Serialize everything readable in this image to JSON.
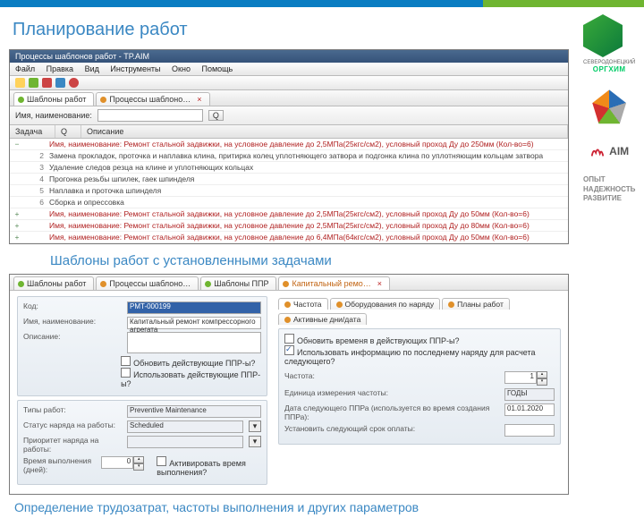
{
  "page_title": "Планирование работ",
  "caption_templates": "Шаблоны работ с установленными задачами",
  "caption_params": "Определение трудозатрат, частоты выполнения и других параметров",
  "win1": {
    "title": "Процессы шаблонов работ - TP.AIM",
    "menu": [
      "Файл",
      "Правка",
      "Вид",
      "Инструменты",
      "Окно",
      "Помощь"
    ],
    "tabs": [
      {
        "label": "Шаблоны работ"
      },
      {
        "label": "Процессы шаблоно…"
      }
    ],
    "search": {
      "name": "Имя, наименование:",
      "q": "Q"
    },
    "gridcols": [
      "Задача",
      "Q",
      "Описание"
    ],
    "rows": [
      {
        "red": true,
        "exp": "−",
        "n": "",
        "t": "Имя, наименование: Ремонт стальной задвижки, на условное давление до 2,5МПа(25кгс/см2), условный проход Ду до 250мм (Кол-во=6)"
      },
      {
        "n": "2",
        "t": "Замена прокладок, проточка и наплавка клина, притирка колец уплотняющего затвора и подгонка клина по уплотняющим кольцам затвора"
      },
      {
        "n": "3",
        "t": "Удаление следов резца на клине и уплотняющих кольцах"
      },
      {
        "n": "4",
        "t": "Прогонка резьбы шпилек, гаек шпинделя"
      },
      {
        "n": "5",
        "t": "Наплавка и проточка шпинделя"
      },
      {
        "n": "6",
        "t": "Сборка и опрессовка"
      },
      {
        "red": true,
        "exp": "+",
        "n": "",
        "t": "Имя, наименование: Ремонт стальной задвижки, на условное давление до 2,5МПа(25кгс/см2), условный проход Ду до 50мм (Кол-во=6)"
      },
      {
        "red": true,
        "exp": "+",
        "n": "",
        "t": "Имя, наименование: Ремонт стальной задвижки, на условное давление до 2,5МПа(25кгс/см2), условный проход Ду до 80мм (Кол-во=6)"
      },
      {
        "red": true,
        "exp": "+",
        "n": "",
        "t": "Имя, наименование: Ремонт стальной задвижки, на условное давление до 6,4МПа(64кгс/см2), условный проход Ду до 50мм (Кол-во=6)"
      }
    ]
  },
  "win2": {
    "tabs": [
      {
        "label": "Шаблоны работ"
      },
      {
        "label": "Процессы шаблоно…"
      },
      {
        "label": "Шаблоны ППР"
      },
      {
        "label": "Капитальный ремо…",
        "active": true
      }
    ],
    "left": {
      "code_label": "Код:",
      "code": "PMT-000199",
      "name_label": "Имя, наименование:",
      "name": "Капитальный ремонт компрессорного агрегата",
      "desc_label": "Описание:",
      "chk1": "Обновить действующие ППР-ы?",
      "chk2": "Использовать действующие ППР-ы?",
      "type_label": "Типы работ:",
      "type": "Preventive Maintenance",
      "status_label": "Статус наряда на работы:",
      "status": "Scheduled",
      "prio_label": "Приоритет наряда на работы:",
      "dur_label": "Время выполнения (дней):",
      "dur": "0",
      "act": "Активировать время выполнения?"
    },
    "right": {
      "tabs": [
        "Частота",
        "Оборудования по наряду",
        "Планы работ",
        "Активные дни/дата"
      ],
      "chk1": "Обновить временя в действующих ППР-ы?",
      "chk2": "Использовать информацию по последнему  наряду для расчета следующего?",
      "freq_label": "Частота:",
      "freq": "1",
      "unit_label": "Единица измерения частоты:",
      "unit": "ГОДЫ",
      "date_label": "Дата следующего ППРа (используется во время создания ППРа):",
      "date": "01.01.2020",
      "nextdate_label": "Установить следующий срок оплаты:"
    }
  },
  "side": {
    "company1": "СЕВЕРОДОНЕЦКИЙ",
    "company2": "ОРГХИМ",
    "aim": "AIM",
    "motto1": "ОПЫТ",
    "motto2": "НАДЕЖНОСТЬ",
    "motto3": "РАЗВИТИЕ"
  }
}
